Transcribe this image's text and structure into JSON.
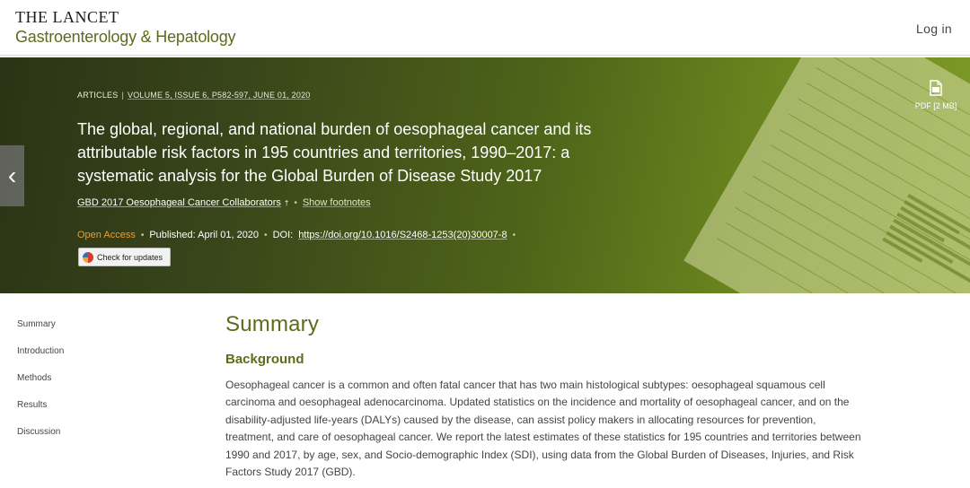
{
  "header": {
    "brand_top": "THE LANCET",
    "brand_sub": "Gastroenterology & Hepatology",
    "login_label": "Log in"
  },
  "banner": {
    "article_type": "ARTICLES",
    "volume_info": "VOLUME 5, ISSUE 6, P582-597, JUNE 01, 2020",
    "title": "The global, regional, and national burden of oesophageal cancer and its attributable risk factors in 195 countries and territories, 1990–2017: a systematic analysis for the Global Burden of Disease Study 2017",
    "authors": "GBD 2017 Oesophageal Cancer Collaborators",
    "author_mark": "†",
    "show_footnotes": "Show footnotes",
    "open_access": "Open Access",
    "published": "Published: April 01, 2020",
    "doi_label": "DOI:",
    "doi_link": "https://doi.org/10.1016/S2468-1253(20)30007-8",
    "check_updates": "Check for updates",
    "pdf_label": "PDF [2 MB]",
    "prev_arrow": "‹"
  },
  "sidebar": {
    "items": [
      {
        "label": "Summary"
      },
      {
        "label": "Introduction"
      },
      {
        "label": "Methods"
      },
      {
        "label": "Results"
      },
      {
        "label": "Discussion"
      }
    ]
  },
  "main": {
    "summary_heading": "Summary",
    "background_heading": "Background",
    "background_text": "Oesophageal cancer is a common and often fatal cancer that has two main histological subtypes: oesophageal squamous cell carcinoma and oesophageal adenocarcinoma. Updated statistics on the incidence and mortality of oesophageal cancer, and on the disability-adjusted life-years (DALYs) caused by the disease, can assist policy makers in allocating resources for prevention, treatment, and care of oesophageal cancer. We report the latest estimates of these statistics for 195 countries and territories between 1990 and 2017, by age, sex, and Socio-demographic Index (SDI), using data from the Global Burden of Diseases, Injuries, and Risk Factors Study 2017 (GBD)."
  },
  "colors": {
    "brand_green": "#5b6d1a",
    "banner_dark": "#2b3316",
    "banner_light": "#7e9a26",
    "open_access": "#f39a2c"
  }
}
